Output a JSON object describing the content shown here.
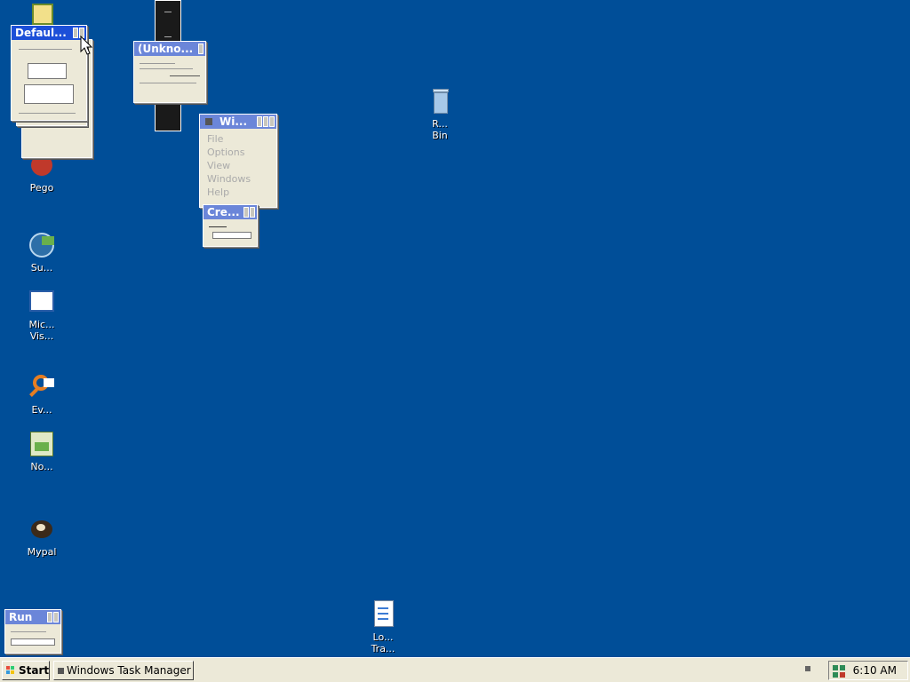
{
  "desktop": {
    "icons": [
      {
        "label": "Pego"
      },
      {
        "label": "Su..."
      },
      {
        "label": "Mic... Vis..."
      },
      {
        "label": "Ev..."
      },
      {
        "label": "No..."
      },
      {
        "label": "Mypal"
      },
      {
        "label": "Lo... Tra..."
      },
      {
        "label": "R... Bin"
      }
    ]
  },
  "windows": {
    "default": {
      "title": "Defaul..."
    },
    "unknown": {
      "title": "(Unkno..."
    },
    "wi": {
      "title": "Wi...",
      "menu": [
        "File",
        "Options",
        "View",
        "Windows",
        "Help"
      ]
    },
    "cre": {
      "title": "Cre..."
    },
    "run": {
      "title": "Run"
    }
  },
  "taskbar": {
    "start_label": "Start",
    "task_button": "Windows Task Manager",
    "clock": "6:10 AM"
  },
  "colors": {
    "desktop": "#004e98",
    "taskbar": "#ece9d8",
    "title_active": "#1c4fd8",
    "title_inactive": "#6b86d9"
  }
}
